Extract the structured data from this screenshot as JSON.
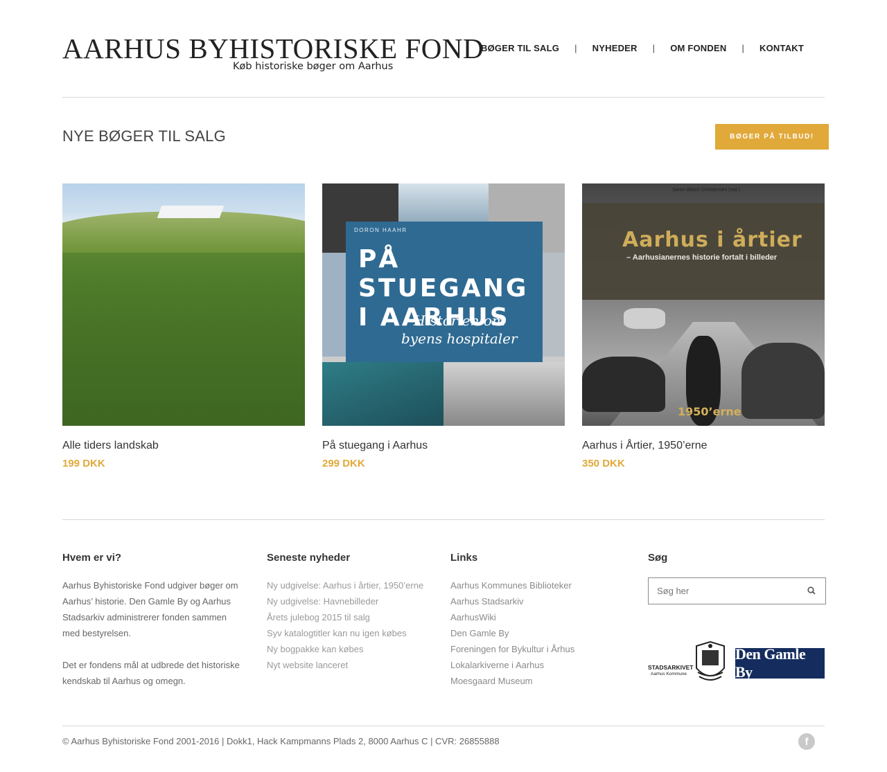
{
  "header": {
    "logo_title": "AARHUS BYHISTORISKE FOND",
    "logo_subtitle": "Køb historiske bøger om Aarhus",
    "nav": [
      "BØGER TIL SALG",
      "NYHEDER",
      "OM FONDEN",
      "KONTAKT"
    ],
    "nav_separator": "|"
  },
  "main": {
    "section_title": "NYE BØGER TIL SALG",
    "offer_button": "BØGER PÅ TILBUD!",
    "products": [
      {
        "title": "Alle tiders landskab",
        "price": "199 DKK"
      },
      {
        "title": "På stuegang i Aarhus",
        "price": "299 DKK"
      },
      {
        "title": "Aarhus i Årtier, 1950’erne",
        "price": "350 DKK"
      }
    ],
    "covers": {
      "c2_author": "DORON HAAHR",
      "c2_title_1": "PÅ STUEGANG",
      "c2_title_2": "I AARHUS",
      "c2_sub_1": "Historien om",
      "c2_sub_2": "byens hospitaler",
      "c3_editor": "Søren Bitsch Christensen (red.)",
      "c3_title": "Aarhus i årtier",
      "c3_sub": "– Aarhusianernes historie fortalt i billeder",
      "c3_decade": "1950’erne"
    }
  },
  "footer": {
    "about": {
      "heading": "Hvem er vi?",
      "p1": "Aarhus Byhistoriske Fond udgiver bøger om Aarhus’ historie. Den Gamle By og Aarhus Stadsarkiv administrerer fonden sammen med bestyrelsen.",
      "p2": "Det er fondens mål at udbrede det historiske kendskab til Aarhus og omegn."
    },
    "news": {
      "heading": "Seneste nyheder",
      "items": [
        "Ny udgivelse: Aarhus i årtier, 1950’erne",
        "Ny udgivelse: Havnebilleder",
        "Årets julebog 2015 til salg",
        "Syv katalogtitler kan nu igen købes",
        "Ny bogpakke kan købes",
        "Nyt website lanceret"
      ]
    },
    "links": {
      "heading": "Links",
      "items": [
        "Aarhus Kommunes Biblioteker",
        "Aarhus Stadsarkiv",
        "AarhusWiki",
        "Den Gamle By",
        "Foreningen for Bykultur i Århus",
        "Lokalarkiverne i Aarhus",
        "Moesgaard Museum"
      ]
    },
    "search": {
      "heading": "Søg",
      "placeholder": "Søg her"
    },
    "partner_logos": {
      "stadsarkivet": "STADSARKIVET",
      "stadsarkivet_sub": "Aarhus Kommune",
      "den_gamle_by": "Den Gamle By"
    },
    "copyright": "© Aarhus Byhistoriske Fond 2001-2016 | Dokk1, Hack Kampmanns Plads 2, 8000 Aarhus C | CVR: 26855888",
    "social": "f"
  },
  "colors": {
    "accent": "#e0a93a",
    "divider": "#d8d8d8",
    "den_gamle_by_blue": "#152d5e"
  }
}
